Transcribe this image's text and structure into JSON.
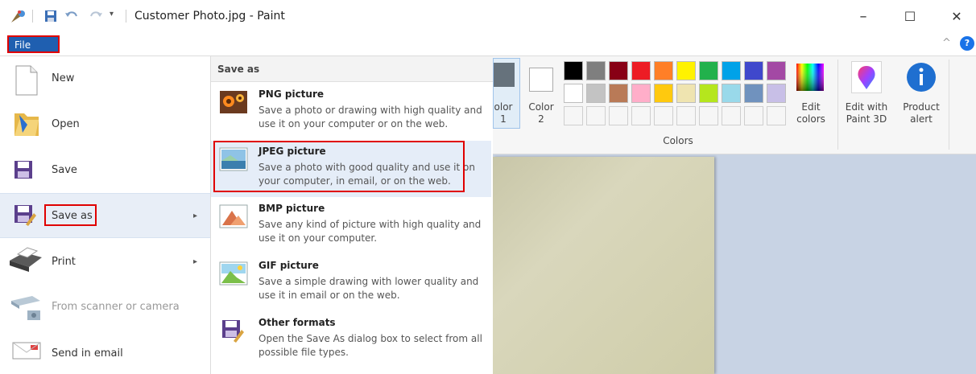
{
  "window": {
    "title": "Customer Photo.jpg - Paint",
    "minimize_glyph": "–",
    "maximize_glyph": "☐",
    "close_glyph": "✕",
    "qat_dropdown_glyph": "▾"
  },
  "ribbon": {
    "file_tab": "File",
    "collapse_glyph": "^",
    "help_glyph": "?",
    "color1_label": "olor\n1",
    "color2_label": "Color\n2",
    "colors_group_label": "Colors",
    "edit_colors_label": "Edit\ncolors",
    "edit_paint3d_label": "Edit with\nPaint 3D",
    "product_alert_label": "Product\nalert",
    "palette_row1": [
      "#000000",
      "#7f7f7f",
      "#880015",
      "#ed1c24",
      "#ff7f27",
      "#fff200",
      "#22b14c",
      "#00a2e8",
      "#3f48cc",
      "#a349a4"
    ],
    "palette_row2": [
      "#ffffff",
      "#c3c3c3",
      "#b97a57",
      "#ffaec9",
      "#ffc90e",
      "#efe4b0",
      "#b5e61d",
      "#99d9ea",
      "#7092be",
      "#c8bfe7"
    ]
  },
  "file_menu": {
    "items": [
      {
        "label": "New",
        "icon": "new-file-icon"
      },
      {
        "label": "Open",
        "icon": "open-folder-icon"
      },
      {
        "label": "Save",
        "icon": "save-icon"
      },
      {
        "label": "Save as",
        "icon": "save-as-icon"
      },
      {
        "label": "Print",
        "icon": "printer-icon"
      },
      {
        "label": "From scanner or camera",
        "icon": "scanner-icon"
      },
      {
        "label": "Send in email",
        "icon": "email-icon"
      }
    ],
    "submenu_arrow": "▸"
  },
  "save_as": {
    "header": "Save as",
    "options": [
      {
        "title": "PNG picture",
        "desc": "Save a photo or drawing with high quality and use it on your computer or on the web.",
        "icon": "png-picture-icon"
      },
      {
        "title": "JPEG picture",
        "desc": "Save a photo with good quality and use it on your computer, in email, or on the web.",
        "icon": "jpeg-picture-icon"
      },
      {
        "title": "BMP picture",
        "desc": "Save any kind of picture with high quality and use it on your computer.",
        "icon": "bmp-picture-icon"
      },
      {
        "title": "GIF picture",
        "desc": "Save a simple drawing with lower quality and use it in email or on the web.",
        "icon": "gif-picture-icon"
      },
      {
        "title": "Other formats",
        "desc": "Open the Save As dialog box to select from all possible file types.",
        "icon": "other-formats-icon"
      }
    ]
  },
  "colors": {
    "highlight_red": "#e00000",
    "file_blue": "#1f5fb0"
  }
}
